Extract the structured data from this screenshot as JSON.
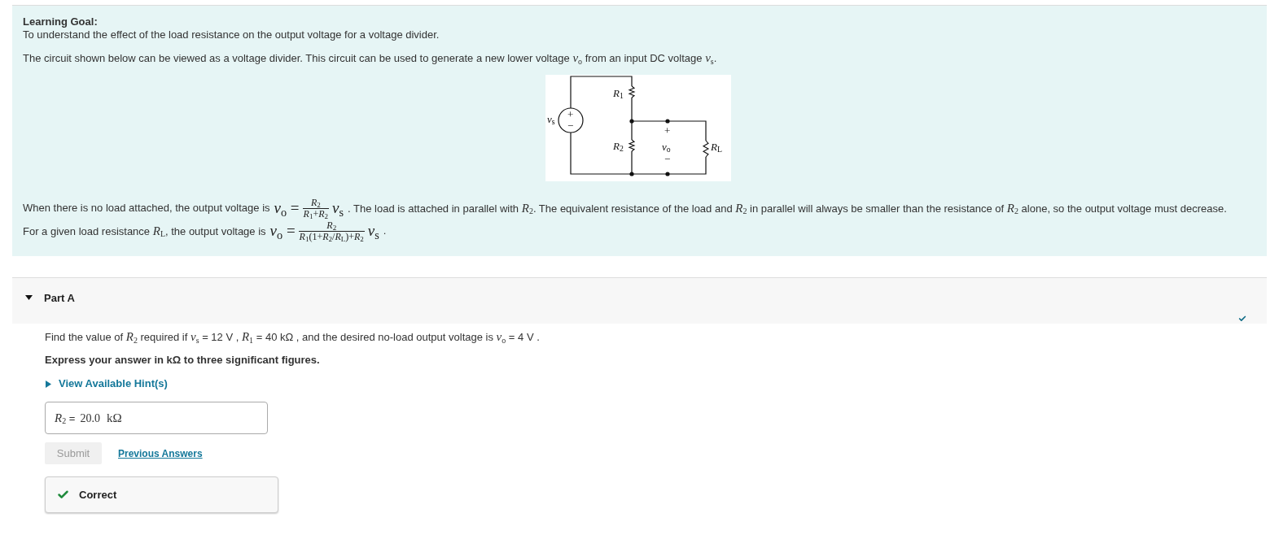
{
  "learning_goal": {
    "heading": "Learning Goal:",
    "text": "To understand the effect of the load resistance on the output voltage for a voltage divider."
  },
  "intro": "The circuit shown below can be viewed as a voltage divider. This circuit can be used to generate a new lower voltage *v*$_{o}$ from an input DC voltage *v*$_{s}$.",
  "circuit": {
    "source_label": "*v*$_{s}$",
    "source_plus": "+",
    "source_minus": "−",
    "r1_label": "*R*$_{1}$",
    "r2_label": "*R*$_{2}$",
    "load_label": "*R*$_{L}$",
    "output_label": "*v*$_{o}$",
    "output_plus": "+",
    "output_minus": "−"
  },
  "equations": [
    {
      "before": "When there is no load attached, the output voltage is",
      "formula": {
        "lhs": "*v*$_{o}$ =",
        "numerator": "*R*$_{2}$",
        "denominator": "*R*$_{1}$+*R*$_{2}$",
        "factor": "*v*$_{s}$"
      },
      "after": ". The load is attached in parallel with *R*$_{2}$. The equivalent resistance of the load and *R*$_{2}$ in parallel will always be smaller than the resistance of *R*$_{2}$ alone, so the output voltage must decrease."
    },
    {
      "before": "For a given load resistance *R*$_{L}$, the output voltage is",
      "formula": {
        "lhs": "*v*$_{o}$ =",
        "numerator": "*R*$_{2}$",
        "denominator": "*R*$_{1}$(1+*R*$_{2}$/*R*$_{L}$)+*R*$_{2}$",
        "factor": "*v*$_{s}$"
      },
      "after": "."
    }
  ],
  "part": {
    "title": "Part A",
    "expanded": true,
    "completed": true,
    "question": "Find the value of *R*$_{2}$ required if *v*$_{s}$ = 12 V , *R*$_{1}$ = 40 kΩ , and the desired no-load output voltage is *v*$_{o}$ = 4 V .",
    "instruction": "Express your answer in kΩ to three significant figures.",
    "hint": {
      "label": "View Available Hint(s)",
      "expanded": false
    },
    "answer": {
      "label": "*R*$_{2}$ =",
      "value": "20.0",
      "unit": "kΩ"
    },
    "submit": {
      "label": "Submit",
      "disabled": true
    },
    "previous_answers": "Previous Answers",
    "feedback": {
      "correct": true,
      "text": "Correct"
    }
  }
}
